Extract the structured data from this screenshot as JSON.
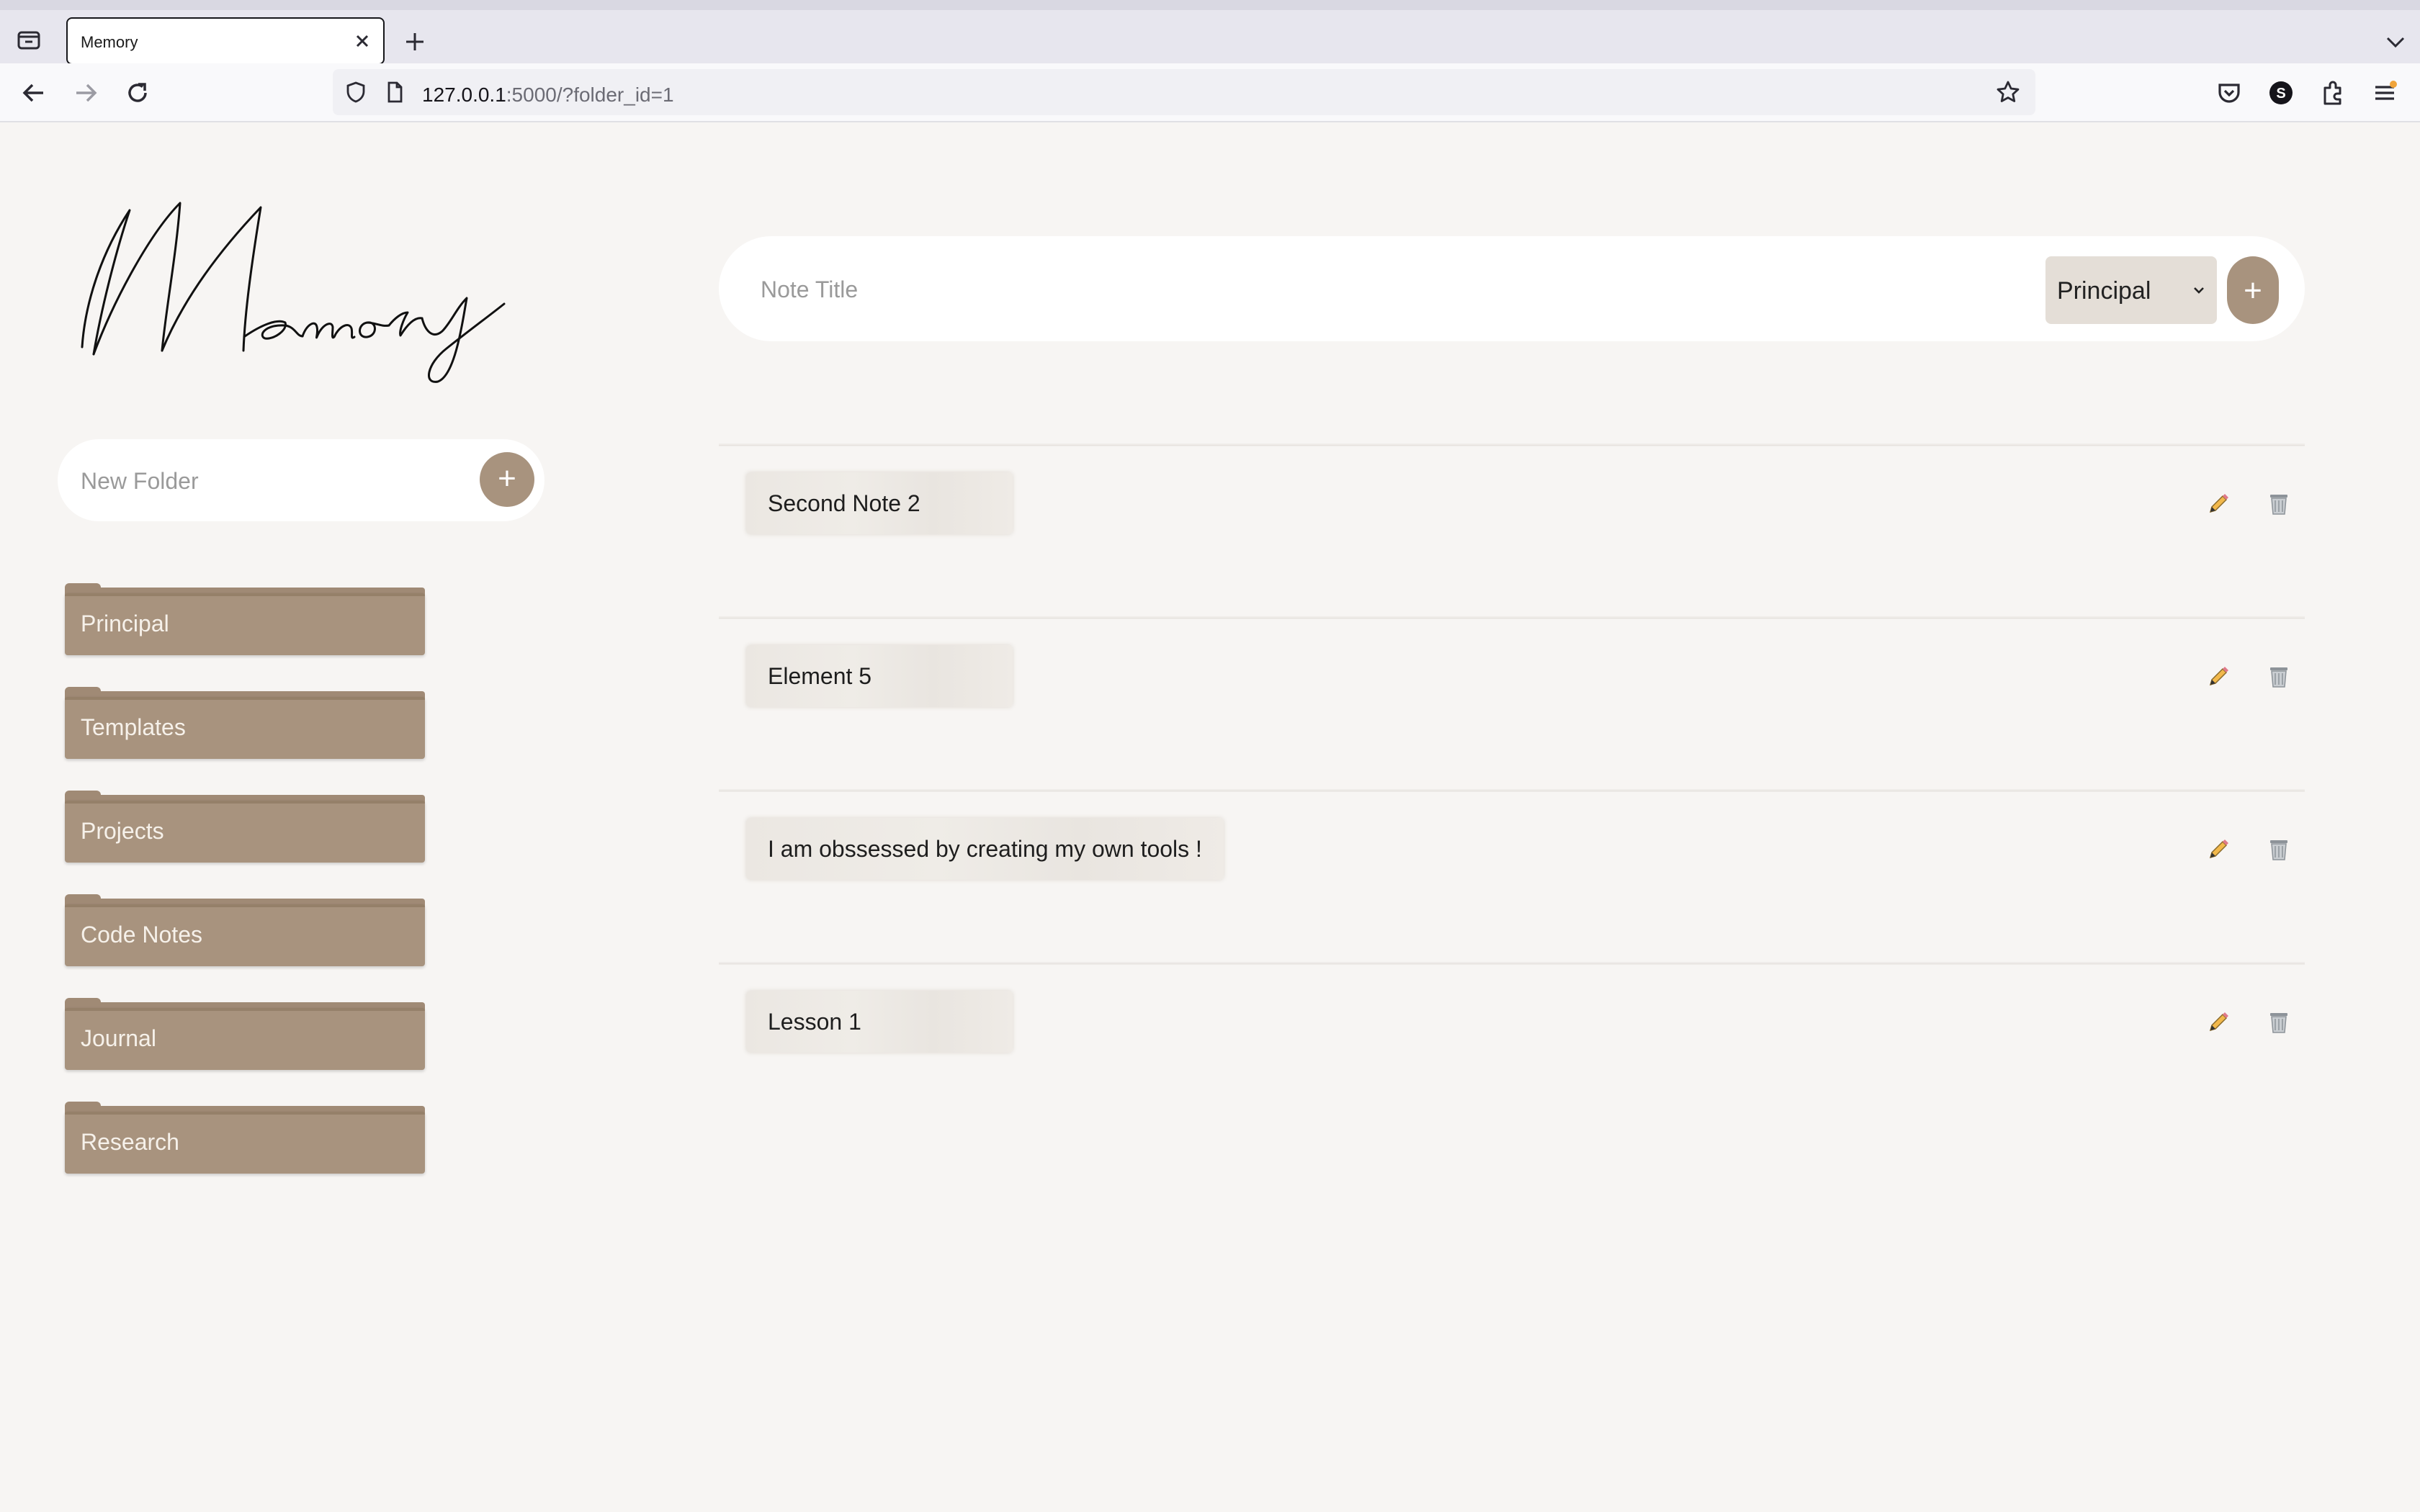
{
  "browser": {
    "tab_title": "Memory",
    "url_host": "127.0.0.1",
    "url_rest": ":5000/?folder_id=1"
  },
  "app": {
    "logo_text": "Memory"
  },
  "sidebar": {
    "new_folder_placeholder": "New Folder",
    "add_label": "+",
    "folders": [
      {
        "label": "Principal"
      },
      {
        "label": "Templates"
      },
      {
        "label": "Projects"
      },
      {
        "label": "Code Notes"
      },
      {
        "label": "Journal"
      },
      {
        "label": "Research"
      }
    ]
  },
  "note_form": {
    "title_placeholder": "Note Title",
    "selected_folder": "Principal",
    "add_label": "+"
  },
  "notes": [
    {
      "title": "Second Note 2"
    },
    {
      "title": "Element 5"
    },
    {
      "title": "I am obssessed by creating my own tools !"
    },
    {
      "title": "Lesson 1"
    }
  ],
  "colors": {
    "accent": "#a8937e",
    "background": "#f7f5f3"
  }
}
